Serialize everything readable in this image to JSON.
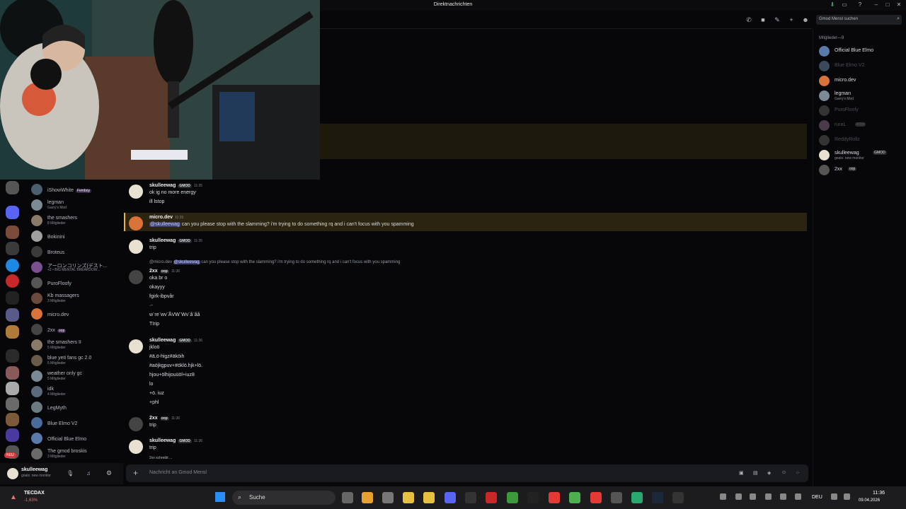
{
  "titlebar": {
    "title": "Direktnachrichten",
    "minimize": "–",
    "maximize": "□",
    "close": "✕"
  },
  "header": {
    "search_placeholder": "Gmod Mensl suchen"
  },
  "dm_list": [
    {
      "name": "iShowWhite",
      "tag": "Femboy",
      "sub": "",
      "color": "#4a6070"
    },
    {
      "name": "legman",
      "tag": "",
      "sub": "Garry's Mod",
      "color": "#7b8a95"
    },
    {
      "name": "the smashers",
      "tag": "",
      "sub": "8 Mitglieder",
      "color": "#8a7a6a"
    },
    {
      "name": "Bokinini",
      "tag": "",
      "sub": "",
      "color": "#a0a0a0"
    },
    {
      "name": "Broteus",
      "tag": "",
      "sub": "",
      "color": "#3a3a3a"
    },
    {
      "name": "アーロンコリンズ(デスト...",
      "tag": "",
      "sub": "+2 • BIG MENTAL BREAKDOW...",
      "color": "#7a5090"
    },
    {
      "name": "PuroFloofy",
      "tag": "",
      "sub": "",
      "color": "#555"
    },
    {
      "name": "Kb massagers",
      "tag": "",
      "sub": "3 Mitglieder",
      "color": "#6a4a3a"
    },
    {
      "name": "micro.dev",
      "tag": "",
      "sub": "",
      "color": "#d9733a"
    },
    {
      "name": "2xx",
      "tag": "oop",
      "sub": "",
      "color": "#444"
    },
    {
      "name": "the smashers II",
      "tag": "",
      "sub": "5 Mitglieder",
      "color": "#8a7a6a"
    },
    {
      "name": "blue yeti fans gc 2.0",
      "tag": "",
      "sub": "5 Mitglieder",
      "color": "#6a5a4a"
    },
    {
      "name": "weather only gc",
      "tag": "",
      "sub": "5 Mitglieder",
      "color": "#7a8a95"
    },
    {
      "name": "idk",
      "tag": "",
      "sub": "4 Mitglieder",
      "color": "#5a6a7a"
    },
    {
      "name": "LegMyth",
      "tag": "",
      "sub": "",
      "color": "#6a7a80"
    },
    {
      "name": "Blue Elmo V2",
      "tag": "",
      "sub": "",
      "color": "#4a6a9a"
    },
    {
      "name": "Official Blue Elmo",
      "tag": "",
      "sub": "",
      "color": "#5a7aaa"
    },
    {
      "name": "The gmod broskis",
      "tag": "",
      "sub": "3 Mitglieder",
      "color": "#6a6a6a"
    }
  ],
  "user_panel": {
    "name": "skulleewag",
    "status": "goals: new monitor"
  },
  "messages": [
    {
      "author": "skulleewag",
      "badge": "GMOD",
      "time": "11:35",
      "lines": [
        "ok ig no more energy",
        "ill lstop"
      ]
    },
    {
      "author": "micro.dev",
      "badge": "",
      "time": "11:35",
      "mention": "@skulleewag",
      "lines": [
        "can you please stop with the slamming? i'm trying to do something rq and i can't focus with you spamming"
      ]
    },
    {
      "author": "skulleewag",
      "badge": "GMOD",
      "time": "11:35",
      "lines": [
        "trip"
      ]
    },
    {
      "reply_author": "@micro.dev",
      "reply_mention": "@skulleewag",
      "reply_text": "can you please stop with the slamming? i'm trying to do something rq and i can't focus with you spamming"
    },
    {
      "author": "2xx",
      "badge": "oop",
      "time": "11:36",
      "lines": [
        "oka br o",
        "okayyy",
        "fgirk-ibpvår",
        "·-",
        "w¨re¨wv¨ÅVW¨Wv¨å¨åå",
        "TIrip"
      ]
    },
    {
      "author": "skulleewag",
      "badge": "GMOD",
      "time": "11:36",
      "lines": [
        "jkloö",
        "#ä.ö-higz#äköih",
        "#aöjkgpuv+#öklö.hjk+lö.",
        "hjou+ölhijouüöl+iuz8",
        "lo",
        "+ö. iuz",
        "+phl"
      ]
    },
    {
      "author": "2xx",
      "badge": "oop",
      "time": "11:36",
      "lines": [
        "trip"
      ]
    },
    {
      "author": "skulleewag",
      "badge": "GMOD",
      "time": "11:36",
      "lines": [
        "trip"
      ]
    }
  ],
  "typing": "2xx schreibt ...",
  "composer": {
    "placeholder": "Nachricht an Gmod Mensl"
  },
  "members": {
    "header": "Mitglieder—9",
    "list": [
      {
        "name": "Official Blue Elmo",
        "sub": "",
        "color": "#dbdee1",
        "av": "#5a7aaa"
      },
      {
        "name": "Blue Elmo V2",
        "sub": "",
        "color": "#4a4d52",
        "av": "#3a4a5a"
      },
      {
        "name": "micro.dev",
        "sub": "",
        "color": "#dbdee1",
        "av": "#d9733a"
      },
      {
        "name": "legman",
        "sub": "Garry's Mod",
        "color": "#dbdee1",
        "av": "#7b8a95"
      },
      {
        "name": "PuroFloofy",
        "sub": "",
        "color": "#4a4d52",
        "av": "#333"
      },
      {
        "name": "ruraL",
        "sub": "",
        "tag": "ASIA",
        "color": "#4a4d52",
        "av": "#4a3a4a"
      },
      {
        "name": "ReddyRollz",
        "sub": "",
        "color": "#4a4d52",
        "av": "#333"
      },
      {
        "name": "skulleewag",
        "sub": "goals: new monitor",
        "tag": "GMOD",
        "color": "#dbdee1",
        "av": "#e8e0d0"
      },
      {
        "name": "2xx",
        "sub": "",
        "tag": "oop",
        "color": "#dbdee1",
        "av": "#555"
      }
    ]
  },
  "taskbar": {
    "stock_name": "TECDAX",
    "stock_change": "-1,63%",
    "search": "Suche",
    "lang": "DEU",
    "time": "11:36",
    "date": "09.04.2026"
  },
  "guild_badge": "NEU"
}
